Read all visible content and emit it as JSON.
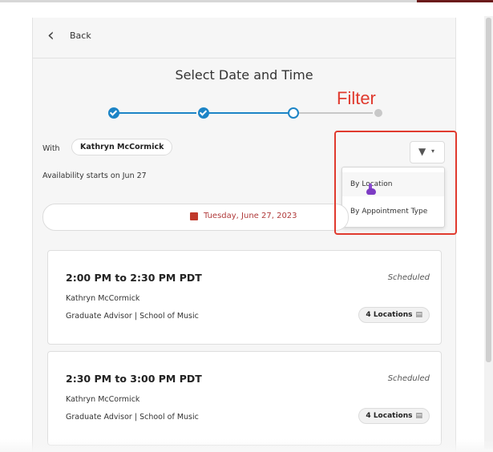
{
  "header": {
    "back_label": "Back"
  },
  "page": {
    "title": "Select Date and Time"
  },
  "stepper": {
    "steps": [
      "done",
      "done",
      "current",
      "pending"
    ]
  },
  "filter": {
    "with_label": "With",
    "advisor": "Kathryn McCormick",
    "availability": "Availability starts on Jun 27",
    "button_icon": "filter-icon",
    "options": [
      "By Location",
      "By Appointment Type"
    ]
  },
  "date": {
    "label": "Tuesday, June 27, 2023"
  },
  "slots": [
    {
      "time": "2:00 PM to 2:30 PM PDT",
      "status": "Scheduled",
      "advisor": "Kathryn McCormick",
      "role": "Graduate Advisor | School of Music",
      "locations": "4 Locations"
    },
    {
      "time": "2:30 PM to 3:00 PM PDT",
      "status": "Scheduled",
      "advisor": "Kathryn McCormick",
      "role": "Graduate Advisor | School of Music",
      "locations": "4 Locations"
    }
  ],
  "annotation": {
    "label": "Filter",
    "color": "#e03a2e"
  },
  "colors": {
    "accent": "#1c84c6",
    "date": "#b03a3a"
  }
}
